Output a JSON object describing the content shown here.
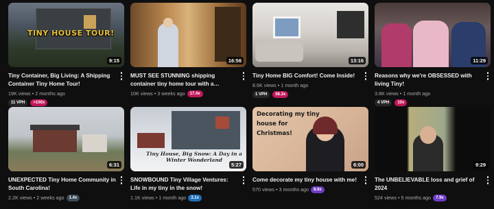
{
  "videos": [
    {
      "title": "Tiny Container, Big Living: A Shipping Container Tiny Home Tour!",
      "duration": "9:15",
      "views": "19K views",
      "age": "2 months ago",
      "badges_row": [
        {
          "text": "11 VPH",
          "color": "#272727"
        },
        {
          "text": ">100x",
          "color": "#c2185b"
        }
      ],
      "overlay": "TINY HOUSE TOUR!"
    },
    {
      "title": "MUST SEE STUNNING shipping container tiny home tour with a beautiful, whimsical...",
      "duration": "16:56",
      "views": "10K views",
      "age": "3 weeks ago",
      "inline_badge": {
        "text": "17.4x",
        "color": "#c2185b"
      }
    },
    {
      "title": "Tiny Home BIG Comfort! Come Inside!",
      "duration": "13:16",
      "views": "8.6K views",
      "age": "1 month ago",
      "badges_row": [
        {
          "text": "1 VPH",
          "color": "#272727"
        },
        {
          "text": "56.3x",
          "color": "#c2185b"
        }
      ]
    },
    {
      "title": "Reasons why we're OBSESSED with living Tiny!",
      "duration": "11:29",
      "views": "3.8K views",
      "age": "1 month ago",
      "badges_row": [
        {
          "text": "4 VPH",
          "color": "#272727"
        },
        {
          "text": "10x",
          "color": "#c2185b"
        }
      ]
    },
    {
      "title": "UNEXPECTED Tiny Home Community in South Carolina!",
      "duration": "6:31",
      "views": "2.2K views",
      "age": "2 weeks ago",
      "inline_badge": {
        "text": "1.4x",
        "color": "#3d4a56"
      }
    },
    {
      "title": "SNOWBOUND Tiny Village Ventures: Life in my tiny in the snow!",
      "duration": "5:27",
      "views": "1.1K views",
      "age": "1 month ago",
      "inline_badge": {
        "text": "3.1x",
        "color": "#1e6fb8"
      },
      "overlay": "Tiny House, Big Snow: A Day in a Winter Wonderland"
    },
    {
      "title": "Come decorate my tiny house with me!",
      "duration": "6:00",
      "views": "570 views",
      "age": "3 months ago",
      "inline_badge": {
        "text": "8.6x",
        "color": "#6f3cc4"
      },
      "overlay": "Decorating my tiny house for Christmas!"
    },
    {
      "title": "The UNBELIEVABLE loss and grief of 2024",
      "duration": "9:29",
      "views": "524 views",
      "age": "5 months ago",
      "inline_badge": {
        "text": "7.9x",
        "color": "#6f3cc4"
      }
    }
  ]
}
